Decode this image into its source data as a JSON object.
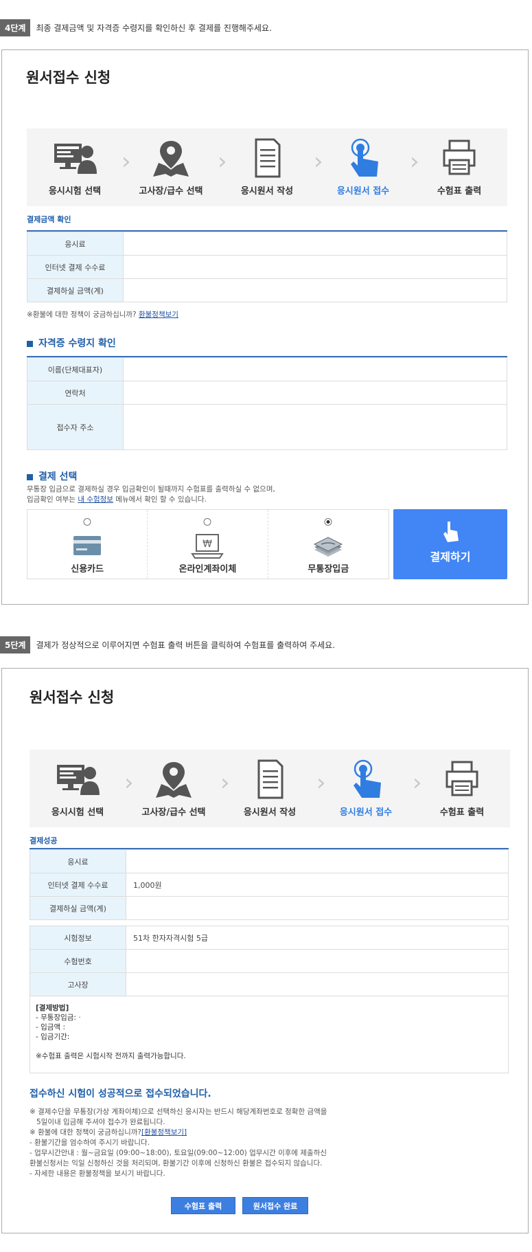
{
  "step4": {
    "badge": "4단계",
    "desc": "최종 결제금액 및 자격증 수령지를 확인하신 후 결제를 진행해주세요.",
    "title": "원서접수 신청",
    "progress": [
      "응시시험 선택",
      "고사장/급수 선택",
      "응시원서 작성",
      "응시원서 접수",
      "수험표 출력"
    ],
    "payment_confirm_title": "결제금액 확인",
    "payment_rows": [
      {
        "label": "응시료",
        "value": ""
      },
      {
        "label": "인터넷 결제 수수료",
        "value": ""
      },
      {
        "label": "결제하실 금액(계)",
        "value": ""
      }
    ],
    "refund_note": "※환불에 대한 정책이 궁금하십니까?",
    "refund_link": "환불정책보기",
    "cert_title": "자격증 수령지 확인",
    "cert_rows": [
      {
        "label": "이름(단체대표자)",
        "value": ""
      },
      {
        "label": "연락처",
        "value": ""
      },
      {
        "label": "접수자 주소",
        "value": ""
      }
    ],
    "pay_select_title": "결제 선택",
    "pay_note_1": "무통장 입금으로 결제하실 경우 입금확인이 될때까지 수험표를 출력하실 수 없으며,",
    "pay_note_2a": "입금확인 여부는",
    "pay_note_link": "내 수험정보",
    "pay_note_2b": "메뉴에서 확인 할 수 있습니다.",
    "pay_options": [
      {
        "label": "신용카드",
        "selected": false,
        "icon": "credit-card-icon"
      },
      {
        "label": "온라인계좌이체",
        "selected": false,
        "icon": "laptop-won-icon"
      },
      {
        "label": "무통장입금",
        "selected": true,
        "icon": "cash-stack-icon"
      }
    ],
    "pay_button": "결제하기"
  },
  "step5": {
    "badge": "5단계",
    "desc": "결제가 정상적으로 이루어지면 수험표 출력 버튼을 클릭하여 수험표를 출력하여 주세요.",
    "title": "원서접수 신청",
    "progress": [
      "응시시험 선택",
      "고사장/급수 선택",
      "응시원서 작성",
      "응시원서 접수",
      "수험표 출력"
    ],
    "success_sub": "결제성공",
    "payment_rows": [
      {
        "label": "응시료",
        "value": ""
      },
      {
        "label": "인터넷 결제 수수료",
        "value": "1,000원"
      },
      {
        "label": "결제하실 금액(계)",
        "value": ""
      }
    ],
    "exam_rows": [
      {
        "label": "시험정보",
        "value": "51차 한자자격시험 5급"
      },
      {
        "label": "수험번호",
        "value": ""
      },
      {
        "label": "고사장",
        "value": ""
      }
    ],
    "method_title": "[결제방법]",
    "method_lines": [
      "- 무통장입금: ",
      "- 입금액 : ",
      "- 입금기간: "
    ],
    "print_note": "※수험표 출력은 시험시작 전까지 출력가능합니다.",
    "success_title": "접수하신 시험이 성공적으로 접수되었습니다.",
    "notes": [
      "※ 결제수단을 무통장(가상 계좌이체)으로 선택하신 응시자는 반드시 해당계좌번호로 정확한 금액을",
      "   5일이내 입금해 주셔야 접수가 완료됩니다.",
      "- 환불기간을 엄수하여 주시기 바랍니다.",
      "- 업무시간안내 : 월~금요일 (09:00~18:00), 토요일(09:00~12:00) 업무시간 이후에 제출하신",
      "  환불신청서는 익일 신청하신 것을 처리되며, 환불기간 이후에 신청하신 환불은 접수되지 않습니다.",
      "- 자세한 내용은 환불정책을 보시기 바랍니다."
    ],
    "refund_note": "※ 환불에 대한 정책이 궁금하십니까?",
    "refund_link": "[환불정책보기]",
    "btn_print": "수험표 출력",
    "btn_done": "원서접수 완료"
  },
  "colors": {
    "accent": "#2f7de1",
    "title_blue": "#1f5fa8",
    "th_bg": "#e8f4fc",
    "pay_btn": "#4285f4"
  }
}
